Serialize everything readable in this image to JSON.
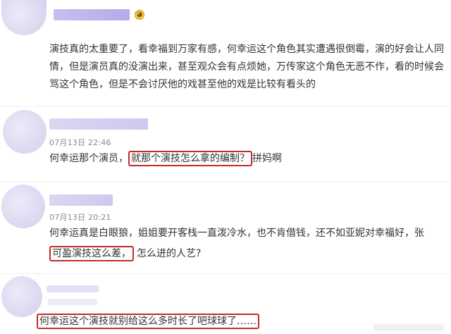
{
  "comments": [
    {
      "text": "演技真的太重要了，看幸福到万家有感，何幸运这个角色其实遭遇很倒霉，演的好会让人同情，但是演员真的没演出来，甚至观众会有点烦她，万传家这个角色无恶不作，看的时候会骂这个角色，但是不会讨厌他的戏甚至他的戏是比较有看头的"
    },
    {
      "time": "07月13日 22:46",
      "pre": "何幸运那个演员，",
      "highlight": "就那个演技怎么拿的编制？",
      "post": "拼妈啊"
    },
    {
      "time": "07月13日 20:21",
      "line1": "何幸运真是白眼狼，姐姐要开客栈一直泼冷水，也不肯借钱，还不如亚妮对幸福好，张",
      "highlight": "可盈演技这么差，",
      "post": "怎么进的人艺?"
    },
    {
      "highlight": "何幸运这个演技就别给这么多时长了吧球球了……"
    }
  ]
}
